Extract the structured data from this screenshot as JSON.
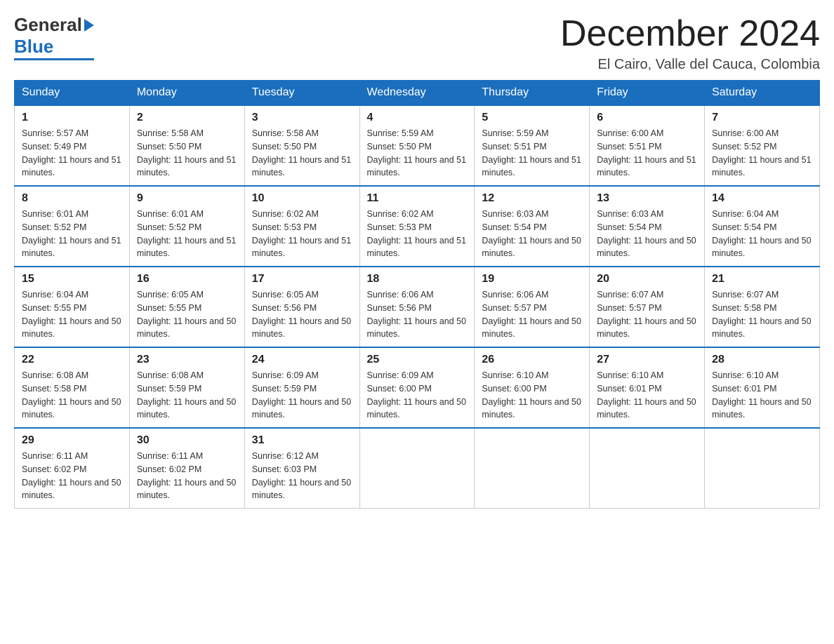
{
  "header": {
    "month_title": "December 2024",
    "location": "El Cairo, Valle del Cauca, Colombia",
    "logo_general": "General",
    "logo_blue": "Blue"
  },
  "days_of_week": [
    "Sunday",
    "Monday",
    "Tuesday",
    "Wednesday",
    "Thursday",
    "Friday",
    "Saturday"
  ],
  "weeks": [
    [
      {
        "day": "1",
        "sunrise": "5:57 AM",
        "sunset": "5:49 PM",
        "daylight": "11 hours and 51 minutes."
      },
      {
        "day": "2",
        "sunrise": "5:58 AM",
        "sunset": "5:50 PM",
        "daylight": "11 hours and 51 minutes."
      },
      {
        "day": "3",
        "sunrise": "5:58 AM",
        "sunset": "5:50 PM",
        "daylight": "11 hours and 51 minutes."
      },
      {
        "day": "4",
        "sunrise": "5:59 AM",
        "sunset": "5:50 PM",
        "daylight": "11 hours and 51 minutes."
      },
      {
        "day": "5",
        "sunrise": "5:59 AM",
        "sunset": "5:51 PM",
        "daylight": "11 hours and 51 minutes."
      },
      {
        "day": "6",
        "sunrise": "6:00 AM",
        "sunset": "5:51 PM",
        "daylight": "11 hours and 51 minutes."
      },
      {
        "day": "7",
        "sunrise": "6:00 AM",
        "sunset": "5:52 PM",
        "daylight": "11 hours and 51 minutes."
      }
    ],
    [
      {
        "day": "8",
        "sunrise": "6:01 AM",
        "sunset": "5:52 PM",
        "daylight": "11 hours and 51 minutes."
      },
      {
        "day": "9",
        "sunrise": "6:01 AM",
        "sunset": "5:52 PM",
        "daylight": "11 hours and 51 minutes."
      },
      {
        "day": "10",
        "sunrise": "6:02 AM",
        "sunset": "5:53 PM",
        "daylight": "11 hours and 51 minutes."
      },
      {
        "day": "11",
        "sunrise": "6:02 AM",
        "sunset": "5:53 PM",
        "daylight": "11 hours and 51 minutes."
      },
      {
        "day": "12",
        "sunrise": "6:03 AM",
        "sunset": "5:54 PM",
        "daylight": "11 hours and 50 minutes."
      },
      {
        "day": "13",
        "sunrise": "6:03 AM",
        "sunset": "5:54 PM",
        "daylight": "11 hours and 50 minutes."
      },
      {
        "day": "14",
        "sunrise": "6:04 AM",
        "sunset": "5:54 PM",
        "daylight": "11 hours and 50 minutes."
      }
    ],
    [
      {
        "day": "15",
        "sunrise": "6:04 AM",
        "sunset": "5:55 PM",
        "daylight": "11 hours and 50 minutes."
      },
      {
        "day": "16",
        "sunrise": "6:05 AM",
        "sunset": "5:55 PM",
        "daylight": "11 hours and 50 minutes."
      },
      {
        "day": "17",
        "sunrise": "6:05 AM",
        "sunset": "5:56 PM",
        "daylight": "11 hours and 50 minutes."
      },
      {
        "day": "18",
        "sunrise": "6:06 AM",
        "sunset": "5:56 PM",
        "daylight": "11 hours and 50 minutes."
      },
      {
        "day": "19",
        "sunrise": "6:06 AM",
        "sunset": "5:57 PM",
        "daylight": "11 hours and 50 minutes."
      },
      {
        "day": "20",
        "sunrise": "6:07 AM",
        "sunset": "5:57 PM",
        "daylight": "11 hours and 50 minutes."
      },
      {
        "day": "21",
        "sunrise": "6:07 AM",
        "sunset": "5:58 PM",
        "daylight": "11 hours and 50 minutes."
      }
    ],
    [
      {
        "day": "22",
        "sunrise": "6:08 AM",
        "sunset": "5:58 PM",
        "daylight": "11 hours and 50 minutes."
      },
      {
        "day": "23",
        "sunrise": "6:08 AM",
        "sunset": "5:59 PM",
        "daylight": "11 hours and 50 minutes."
      },
      {
        "day": "24",
        "sunrise": "6:09 AM",
        "sunset": "5:59 PM",
        "daylight": "11 hours and 50 minutes."
      },
      {
        "day": "25",
        "sunrise": "6:09 AM",
        "sunset": "6:00 PM",
        "daylight": "11 hours and 50 minutes."
      },
      {
        "day": "26",
        "sunrise": "6:10 AM",
        "sunset": "6:00 PM",
        "daylight": "11 hours and 50 minutes."
      },
      {
        "day": "27",
        "sunrise": "6:10 AM",
        "sunset": "6:01 PM",
        "daylight": "11 hours and 50 minutes."
      },
      {
        "day": "28",
        "sunrise": "6:10 AM",
        "sunset": "6:01 PM",
        "daylight": "11 hours and 50 minutes."
      }
    ],
    [
      {
        "day": "29",
        "sunrise": "6:11 AM",
        "sunset": "6:02 PM",
        "daylight": "11 hours and 50 minutes."
      },
      {
        "day": "30",
        "sunrise": "6:11 AM",
        "sunset": "6:02 PM",
        "daylight": "11 hours and 50 minutes."
      },
      {
        "day": "31",
        "sunrise": "6:12 AM",
        "sunset": "6:03 PM",
        "daylight": "11 hours and 50 minutes."
      },
      null,
      null,
      null,
      null
    ]
  ],
  "labels": {
    "sunrise": "Sunrise:",
    "sunset": "Sunset:",
    "daylight": "Daylight:"
  },
  "colors": {
    "header_bg": "#1a6ebd",
    "header_text": "#ffffff",
    "border": "#cccccc",
    "row_border": "#1a6ebd"
  }
}
